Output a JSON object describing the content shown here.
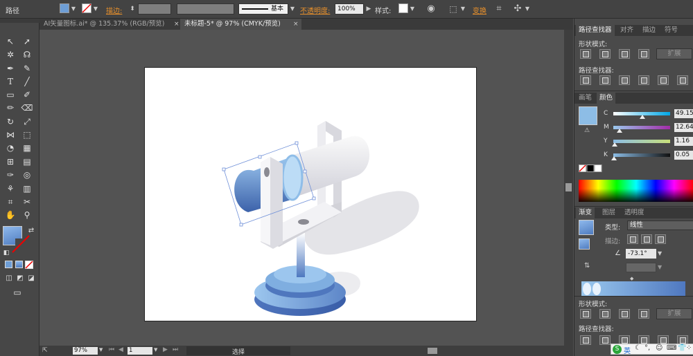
{
  "control_bar": {
    "selection_label": "路径",
    "stroke_label": "描边",
    "stroke_style": "基本",
    "opacity_label": "不透明度",
    "opacity_value": "100%",
    "style_label": "样式",
    "transform_label": "变换",
    "fill_color": "#6e9ed6",
    "accent": "#e8902b"
  },
  "tabs": [
    {
      "label": "AI矢量图标.ai* @ 135.37% (RGB/预览)",
      "active": false
    },
    {
      "label": "未标题-5* @ 97% (CMYK/预览)",
      "active": true
    }
  ],
  "tab_close_icon": "×",
  "pathfinder": {
    "tabs": [
      "路径查找器",
      "对齐",
      "描边",
      "符号"
    ],
    "shape_modes_label": "形状模式",
    "pathfinders_label": "路径查找器",
    "expand_label": "扩展"
  },
  "color": {
    "tabs": [
      "画笔",
      "颜色"
    ],
    "swatch": "#8dbde6",
    "channels": [
      {
        "name": "C",
        "value": "49.15",
        "fraction": 0.49
      },
      {
        "name": "M",
        "value": "12.64",
        "fraction": 0.13
      },
      {
        "name": "Y",
        "value": "1.16",
        "fraction": 0.02
      },
      {
        "name": "K",
        "value": "0.05",
        "fraction": 0.01
      }
    ]
  },
  "gradient": {
    "tabs": [
      "渐变",
      "图层",
      "透明度"
    ],
    "type_label": "类型",
    "type_value": "线性",
    "stroke_label": "描边",
    "angle_value": "-73.1°"
  },
  "lower_panel": {
    "shape_modes_label": "形状模式",
    "pathfinders_label": "路径查找器"
  },
  "status": {
    "zoom": "97%",
    "page": "1",
    "tool": "选择"
  },
  "ime": {
    "label": "英"
  }
}
